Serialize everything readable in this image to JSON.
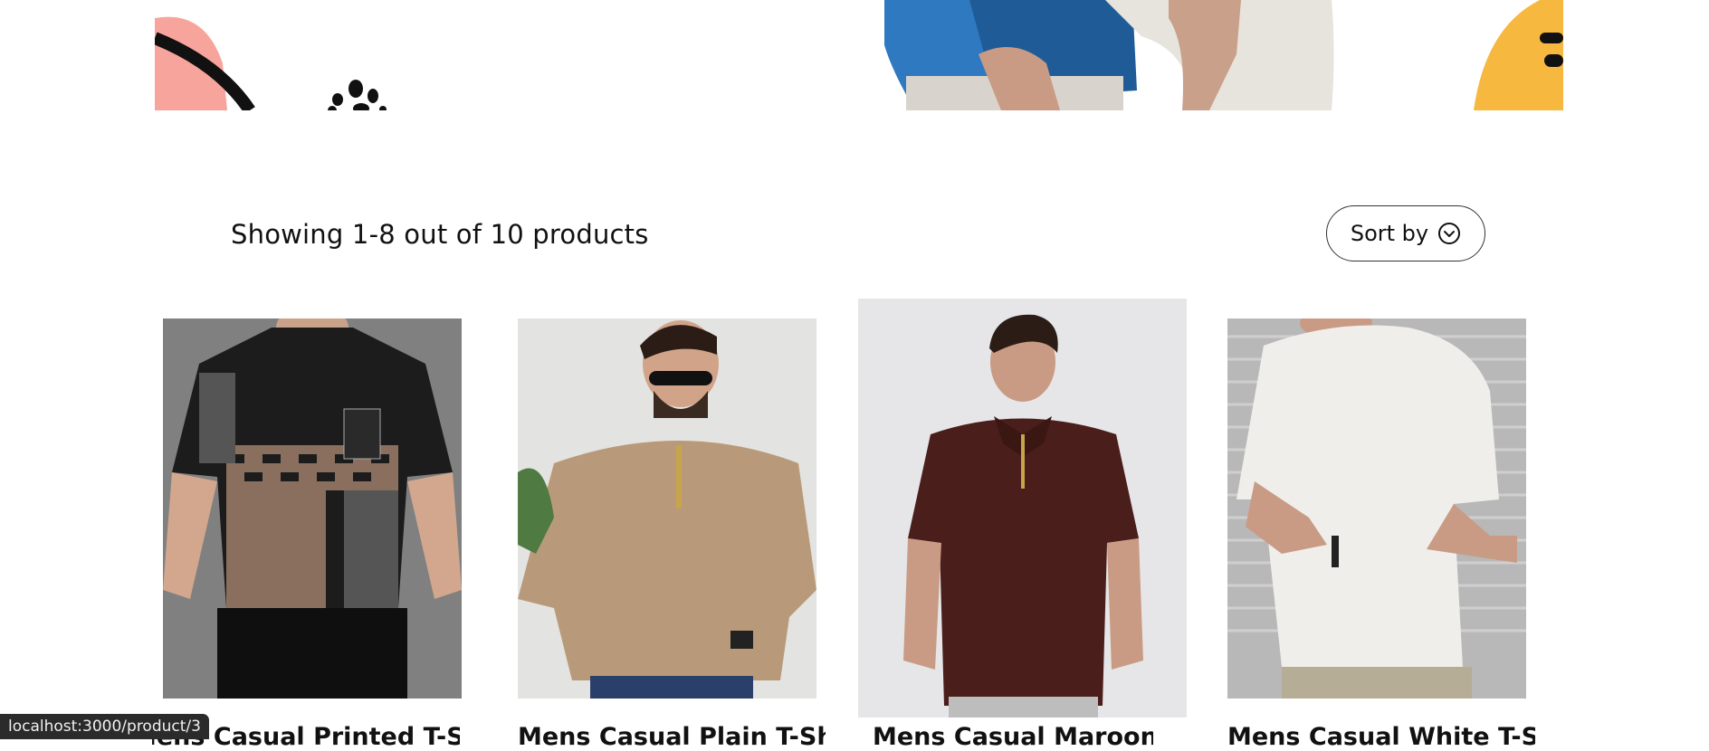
{
  "listing": {
    "count_text": "Showing 1-8 out of 10 products",
    "sort_label": "Sort by"
  },
  "products": [
    {
      "name": "Mens Casual Printed T-Shirt",
      "shirt_color": "#3a3430"
    },
    {
      "name": "Mens Casual Plain T-Shirt",
      "shirt_color": "#b89a7a"
    },
    {
      "name": "Mens Casual Maroon T-Shirt",
      "shirt_color": "#4a1e1a"
    },
    {
      "name": "Mens Casual White T-Shirt",
      "shirt_color": "#f0eeea"
    }
  ],
  "status_bar": {
    "url": "localhost:3000/product/3"
  },
  "colors": {
    "hero_pink": "#f7a59c",
    "hero_blue": "#2f79c0",
    "hero_yellow": "#f6b83f",
    "text": "#111111"
  }
}
